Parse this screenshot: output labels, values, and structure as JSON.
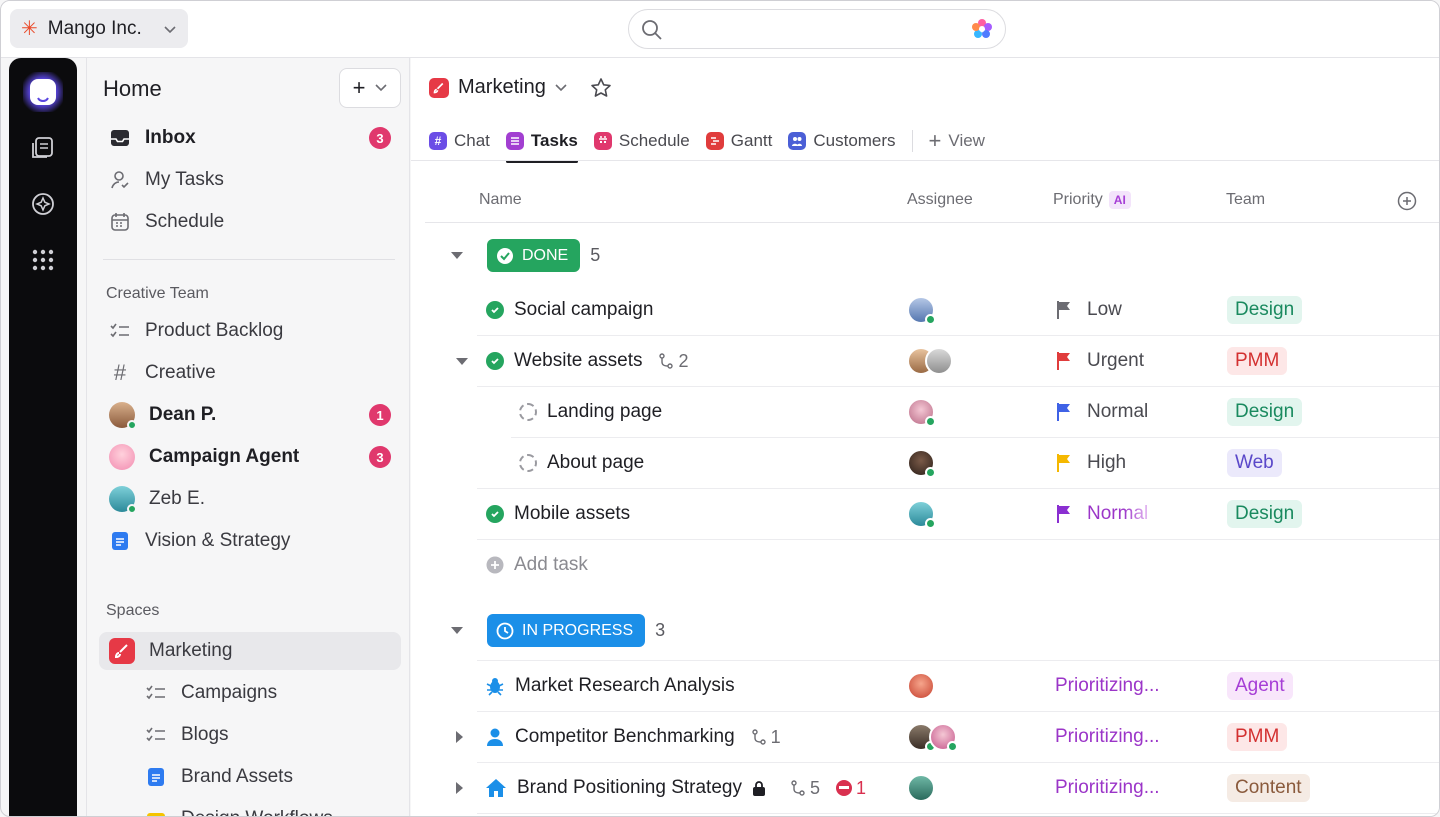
{
  "workspace": {
    "name": "Mango Inc."
  },
  "search": {
    "placeholder": ""
  },
  "sidebar": {
    "title": "Home",
    "nav": [
      {
        "label": "Inbox",
        "badge": "3",
        "icon": "inbox-icon"
      },
      {
        "label": "My Tasks",
        "icon": "person-icon"
      },
      {
        "label": "Schedule",
        "icon": "calendar-icon"
      }
    ],
    "creative_team": {
      "header": "Creative Team",
      "items": [
        {
          "label": "Product Backlog",
          "icon": "checklist-icon"
        },
        {
          "label": "Creative",
          "icon": "hash-icon"
        },
        {
          "label": "Dean P.",
          "badge": "1",
          "icon": "avatar"
        },
        {
          "label": "Campaign Agent",
          "badge": "3",
          "icon": "avatar"
        },
        {
          "label": "Zeb E.",
          "icon": "avatar"
        },
        {
          "label": "Vision & Strategy",
          "icon": "doc-icon"
        }
      ]
    },
    "spaces": {
      "header": "Spaces",
      "items": [
        {
          "label": "Marketing",
          "icon": "brush-icon"
        },
        {
          "label": "Campaigns",
          "icon": "checklist-icon"
        },
        {
          "label": "Blogs",
          "icon": "checklist-icon"
        },
        {
          "label": "Brand Assets",
          "icon": "doc-icon"
        },
        {
          "label": "Design Workflows",
          "icon": "folder-icon"
        }
      ]
    }
  },
  "main": {
    "title": "Marketing",
    "tabs": [
      {
        "label": "Chat",
        "color": "#6b4de6"
      },
      {
        "label": "Tasks",
        "color": "#a23fd1"
      },
      {
        "label": "Schedule",
        "color": "#e0386d"
      },
      {
        "label": "Gantt",
        "color": "#e03c3c"
      },
      {
        "label": "Customers",
        "color": "#4b5fd6"
      }
    ],
    "view_label": "View",
    "columns": {
      "name": "Name",
      "assignee": "Assignee",
      "priority": "Priority",
      "priority_ai": "AI",
      "team": "Team"
    },
    "groups": [
      {
        "status": "DONE",
        "count": "5",
        "color": "#25a55f",
        "add_task": "Add task",
        "rows": [
          {
            "name": "Social campaign",
            "priority": "Low",
            "team": "Design"
          },
          {
            "name": "Website assets",
            "subtasks": "2",
            "priority": "Urgent",
            "team": "PMM"
          },
          {
            "name": "Landing page",
            "priority": "Normal",
            "team": "Design"
          },
          {
            "name": "About page",
            "priority": "High",
            "team": "Web"
          },
          {
            "name": "Mobile assets",
            "priority": "Normal",
            "team": "Design"
          }
        ]
      },
      {
        "status": "IN PROGRESS",
        "count": "3",
        "color": "#1b8fe8",
        "rows": [
          {
            "name": "Market Research Analysis",
            "priority": "Prioritizing...",
            "team": "Agent"
          },
          {
            "name": "Competitor Benchmarking",
            "subtasks": "1",
            "priority": "Prioritizing...",
            "team": "PMM"
          },
          {
            "name": "Brand Positioning Strategy",
            "subtasks": "5",
            "blocked": "1",
            "priority": "Prioritizing...",
            "team": "Content"
          }
        ]
      }
    ]
  },
  "colors": {
    "flag_low": "#6c6c72",
    "flag_urgent": "#e03c3c",
    "flag_normal": "#3f62e6",
    "flag_high": "#f5b800",
    "flag_normal_purple": "#8a2fd1"
  }
}
